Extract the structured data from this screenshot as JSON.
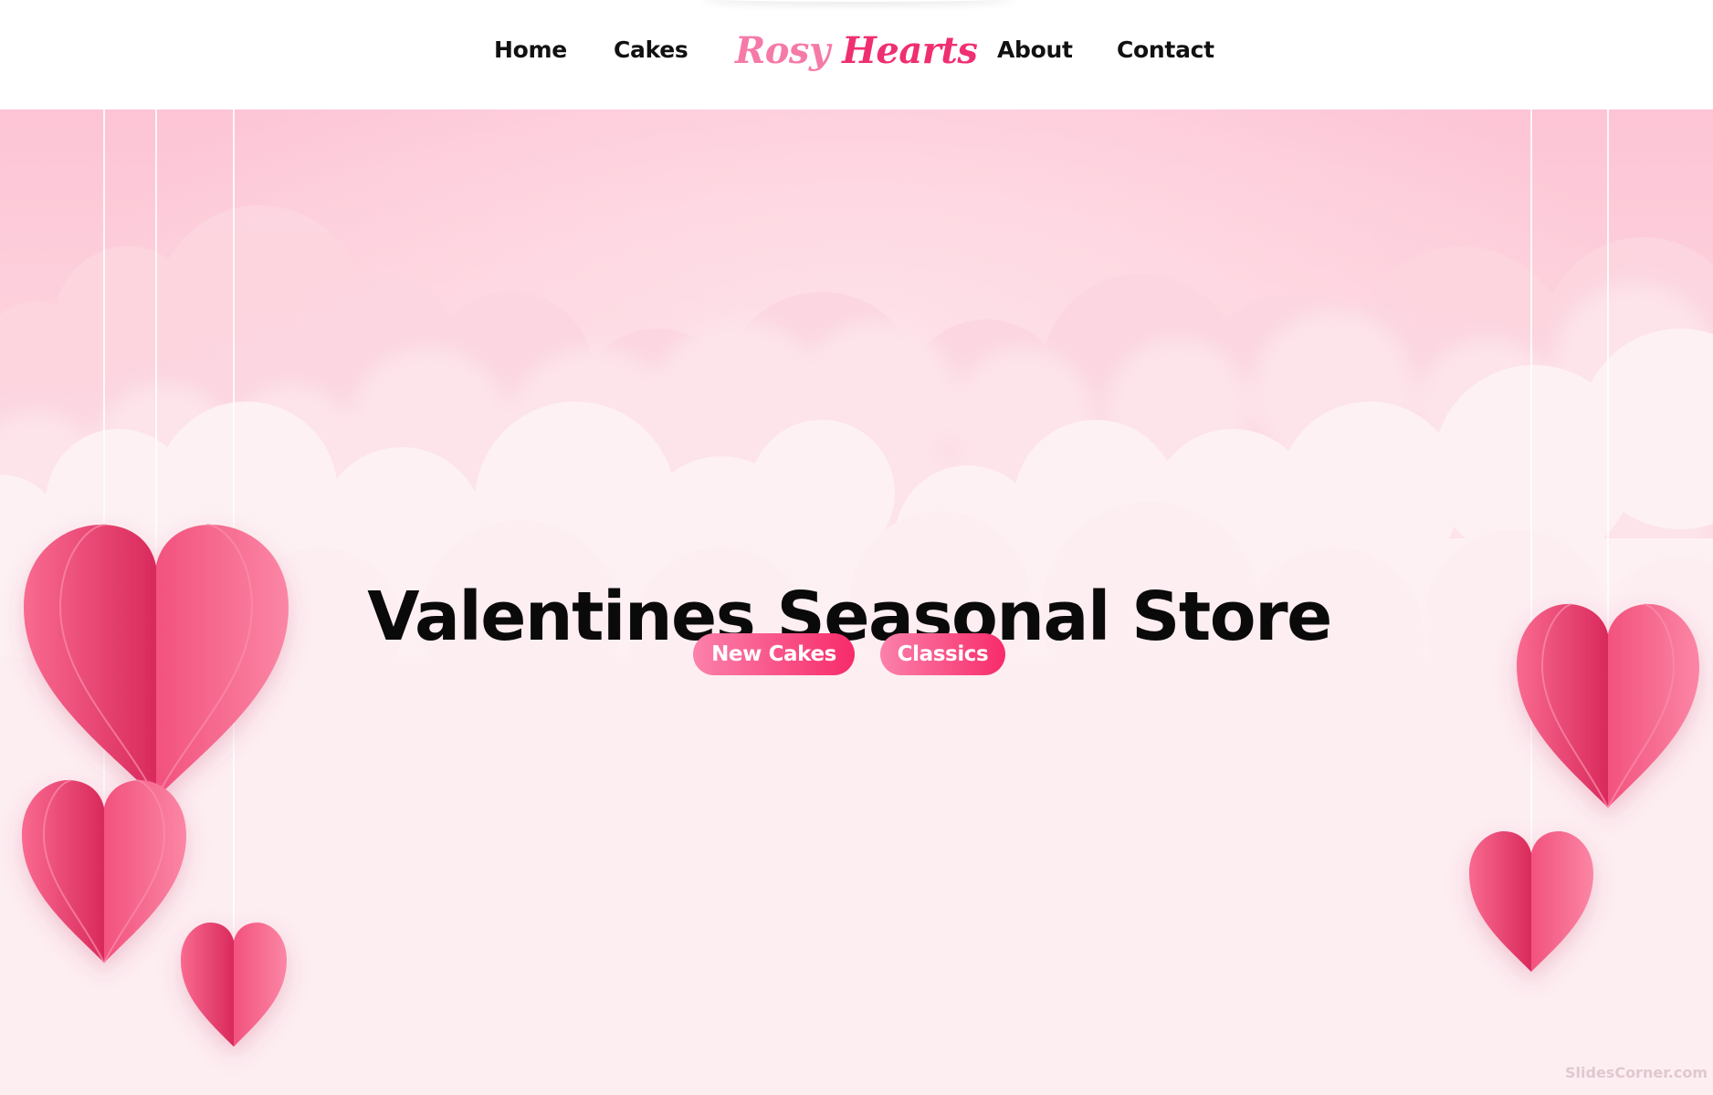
{
  "nav": {
    "home": "Home",
    "cakes": "Cakes",
    "about": "About",
    "contact": "Contact",
    "logo_first": "Rosy",
    "logo_second": "Hearts"
  },
  "hero": {
    "title": "Valentines Seasonal Store",
    "buttons": {
      "new_cakes": "New Cakes",
      "classics": "Classics"
    }
  },
  "watermark": "SlidesCorner.com",
  "colors": {
    "accent_pink": "#f72b6a",
    "light_pink": "#fb81ab",
    "logo_light": "#f57aa8",
    "logo_dark": "#ef2f72",
    "hero_top": "#fdc4d5",
    "hero_bottom": "#fdeff2"
  },
  "decorations": [
    "heart-icon",
    "cloud-shape"
  ]
}
